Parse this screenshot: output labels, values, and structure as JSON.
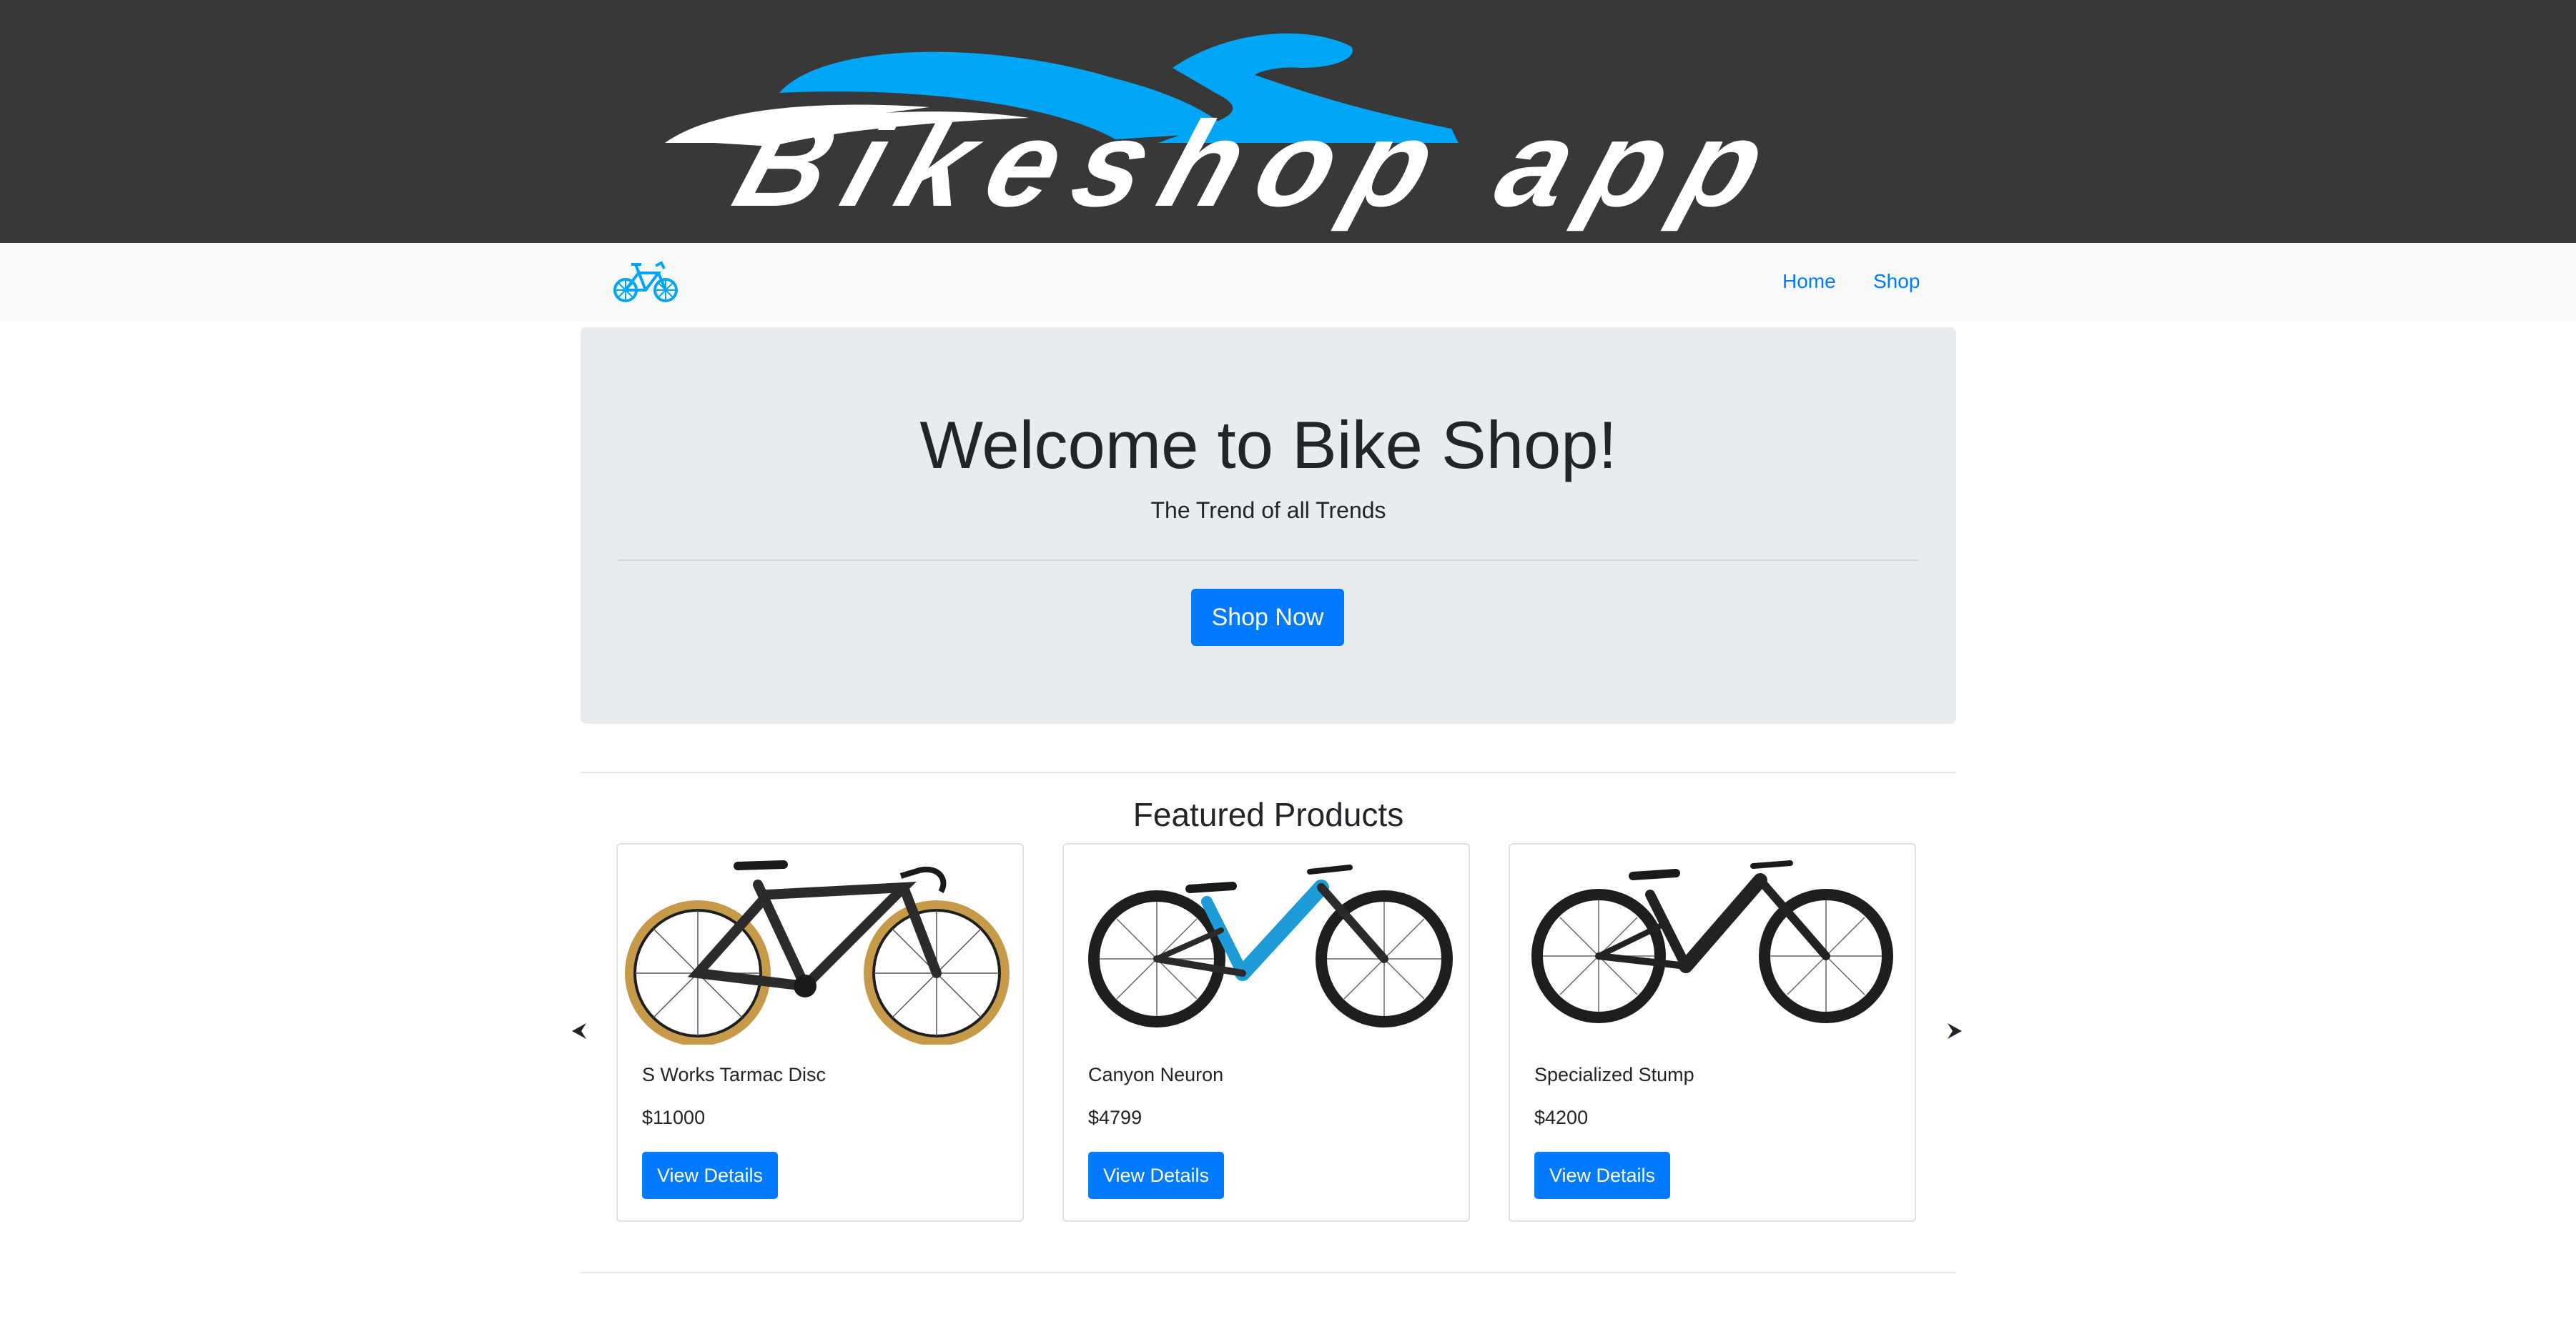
{
  "banner": {
    "logo_text": "Bikeshop app",
    "logo_icon": "cyclist-logo-icon",
    "accent_color": "#00a6f5",
    "background_color": "#383838"
  },
  "navbar": {
    "brand_icon": "bicycle-icon",
    "links": [
      {
        "label": "Home"
      },
      {
        "label": "Shop"
      }
    ],
    "link_color": "#007bff"
  },
  "hero": {
    "title": "Welcome to Bike Shop!",
    "subtitle": "The Trend of all Trends",
    "cta_label": "Shop Now",
    "cta_color": "#007bff"
  },
  "featured": {
    "title": "Featured Products",
    "prev_icon": "chevron-left-icon",
    "next_icon": "chevron-right-icon",
    "products": [
      {
        "name": "S Works Tarmac Disc",
        "price": "$11000",
        "button_label": "View Details",
        "image_icon": "road-bike-icon"
      },
      {
        "name": "Canyon Neuron",
        "price": "$4799",
        "button_label": "View Details",
        "image_icon": "mountain-bike-blue-icon"
      },
      {
        "name": "Specialized Stump",
        "price": "$4200",
        "button_label": "View Details",
        "image_icon": "mountain-bike-black-icon"
      }
    ]
  }
}
